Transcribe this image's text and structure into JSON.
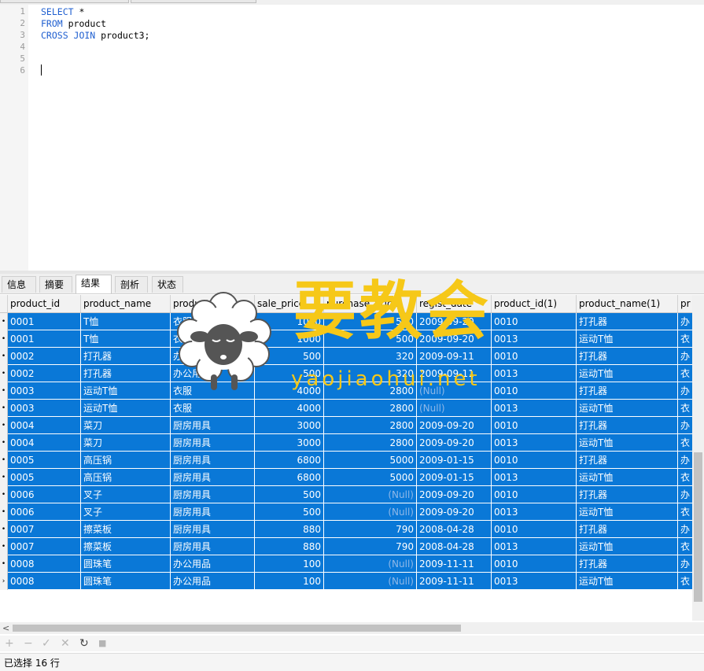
{
  "editor": {
    "line_numbers": [
      "1",
      "2",
      "3",
      "4",
      "5",
      "6"
    ],
    "lines": [
      {
        "kw": "SELECT",
        "rest": " *"
      },
      {
        "kw": "FROM",
        "rest": " product"
      },
      {
        "kw": "CROSS JOIN",
        "rest": " product3;"
      },
      {
        "kw": "",
        "rest": ""
      },
      {
        "kw": "",
        "rest": ""
      },
      {
        "kw": "",
        "rest": ""
      }
    ]
  },
  "result_tabs": [
    "信息",
    "摘要",
    "结果 1",
    "剖析",
    "状态"
  ],
  "active_tab": "结果 1",
  "grid": {
    "columns": [
      "product_id",
      "product_name",
      "product_type",
      "sale_price",
      "purchase_price",
      "regist_date",
      "product_id(1)",
      "product_name(1)",
      "pr"
    ],
    "rows": [
      [
        "0001",
        "T恤",
        "衣服",
        "1000",
        "500",
        "2009-09-20",
        "0010",
        "打孔器",
        "办"
      ],
      [
        "0001",
        "T恤",
        "衣服",
        "1000",
        "500",
        "2009-09-20",
        "0013",
        "运动T恤",
        "衣"
      ],
      [
        "0002",
        "打孔器",
        "办公用品",
        "500",
        "320",
        "2009-09-11",
        "0010",
        "打孔器",
        "办"
      ],
      [
        "0002",
        "打孔器",
        "办公用品",
        "500",
        "320",
        "2009-09-11",
        "0013",
        "运动T恤",
        "衣"
      ],
      [
        "0003",
        "运动T恤",
        "衣服",
        "4000",
        "2800",
        "(Null)",
        "0010",
        "打孔器",
        "办"
      ],
      [
        "0003",
        "运动T恤",
        "衣服",
        "4000",
        "2800",
        "(Null)",
        "0013",
        "运动T恤",
        "衣"
      ],
      [
        "0004",
        "菜刀",
        "厨房用具",
        "3000",
        "2800",
        "2009-09-20",
        "0010",
        "打孔器",
        "办"
      ],
      [
        "0004",
        "菜刀",
        "厨房用具",
        "3000",
        "2800",
        "2009-09-20",
        "0013",
        "运动T恤",
        "衣"
      ],
      [
        "0005",
        "高压锅",
        "厨房用具",
        "6800",
        "5000",
        "2009-01-15",
        "0010",
        "打孔器",
        "办"
      ],
      [
        "0005",
        "高压锅",
        "厨房用具",
        "6800",
        "5000",
        "2009-01-15",
        "0013",
        "运动T恤",
        "衣"
      ],
      [
        "0006",
        "叉子",
        "厨房用具",
        "500",
        "(Null)",
        "2009-09-20",
        "0010",
        "打孔器",
        "办"
      ],
      [
        "0006",
        "叉子",
        "厨房用具",
        "500",
        "(Null)",
        "2009-09-20",
        "0013",
        "运动T恤",
        "衣"
      ],
      [
        "0007",
        "擦菜板",
        "厨房用具",
        "880",
        "790",
        "2008-04-28",
        "0010",
        "打孔器",
        "办"
      ],
      [
        "0007",
        "擦菜板",
        "厨房用具",
        "880",
        "790",
        "2008-04-28",
        "0013",
        "运动T恤",
        "衣"
      ],
      [
        "0008",
        "圆珠笔",
        "办公用品",
        "100",
        "(Null)",
        "2009-11-11",
        "0010",
        "打孔器",
        "办"
      ],
      [
        "0008",
        "圆珠笔",
        "办公用品",
        "100",
        "(Null)",
        "2009-11-11",
        "0013",
        "运动T恤",
        "衣"
      ]
    ],
    "current_row": 15
  },
  "toolbar": {
    "add": "+",
    "remove": "−",
    "apply": "✓",
    "discard": "✕",
    "refresh": "↻",
    "stop": "■"
  },
  "status": {
    "text": "已选择 16 行"
  },
  "watermark": {
    "brand": "要教会",
    "url": "yaojiaohui.net"
  },
  "colors": {
    "selection": "#0a78d7",
    "keyword": "#1f5fd0",
    "watermark": "#f6c818"
  }
}
